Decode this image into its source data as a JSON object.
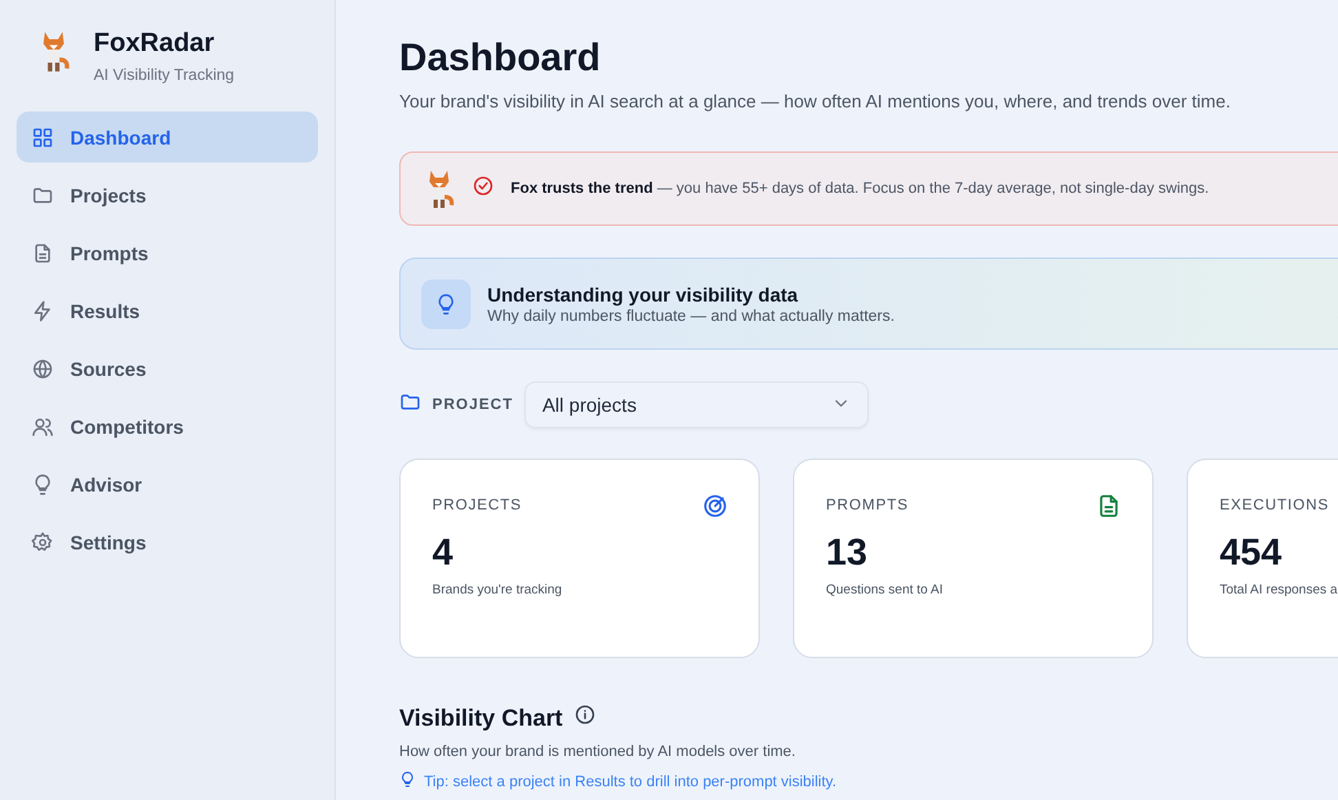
{
  "brand": {
    "name": "FoxRadar",
    "tagline": "AI Visibility Tracking"
  },
  "nav": [
    {
      "kind": "grid",
      "label": "Dashboard",
      "selected": true
    },
    {
      "kind": "folder",
      "label": "Projects",
      "selected": false
    },
    {
      "kind": "file",
      "label": "Prompts",
      "selected": false
    },
    {
      "kind": "bolt",
      "label": "Results",
      "selected": false
    },
    {
      "kind": "globe",
      "label": "Sources",
      "selected": false
    },
    {
      "kind": "users",
      "label": "Competitors",
      "selected": false
    },
    {
      "kind": "bulb",
      "label": "Advisor",
      "selected": false
    },
    {
      "kind": "gear",
      "label": "Settings",
      "selected": false
    }
  ],
  "page": {
    "title": "Dashboard",
    "subtitle": "Your brand's visibility in AI search at a glance — how often AI mentions you, where, and trends over time."
  },
  "trend_banner": {
    "text": "**Fox trusts the trend** — you have 55+ days of data. Focus on the 7-day average, not single-day swings."
  },
  "info_banner": {
    "title": "Understanding your visibility data",
    "text": "Why daily numbers fluctuate — and what actually matters."
  },
  "project_filter": {
    "label": "PROJECT",
    "value": "All projects"
  },
  "stats": [
    {
      "kind": "radar",
      "label": "PROJECTS",
      "value": "4",
      "note": "Brands you're tracking"
    },
    {
      "kind": "file",
      "label": "PROMPTS",
      "value": "13",
      "note": "Questions sent to AI"
    },
    {
      "kind": "none",
      "label": "EXECUTIONS",
      "value": "454",
      "note": "Total AI responses a"
    }
  ],
  "chart_section": {
    "title": "Visibility Chart",
    "description": "How often your brand is mentioned by AI models over time.",
    "tip": "Tip: select a project in Results to drill into per-prompt visibility."
  }
}
